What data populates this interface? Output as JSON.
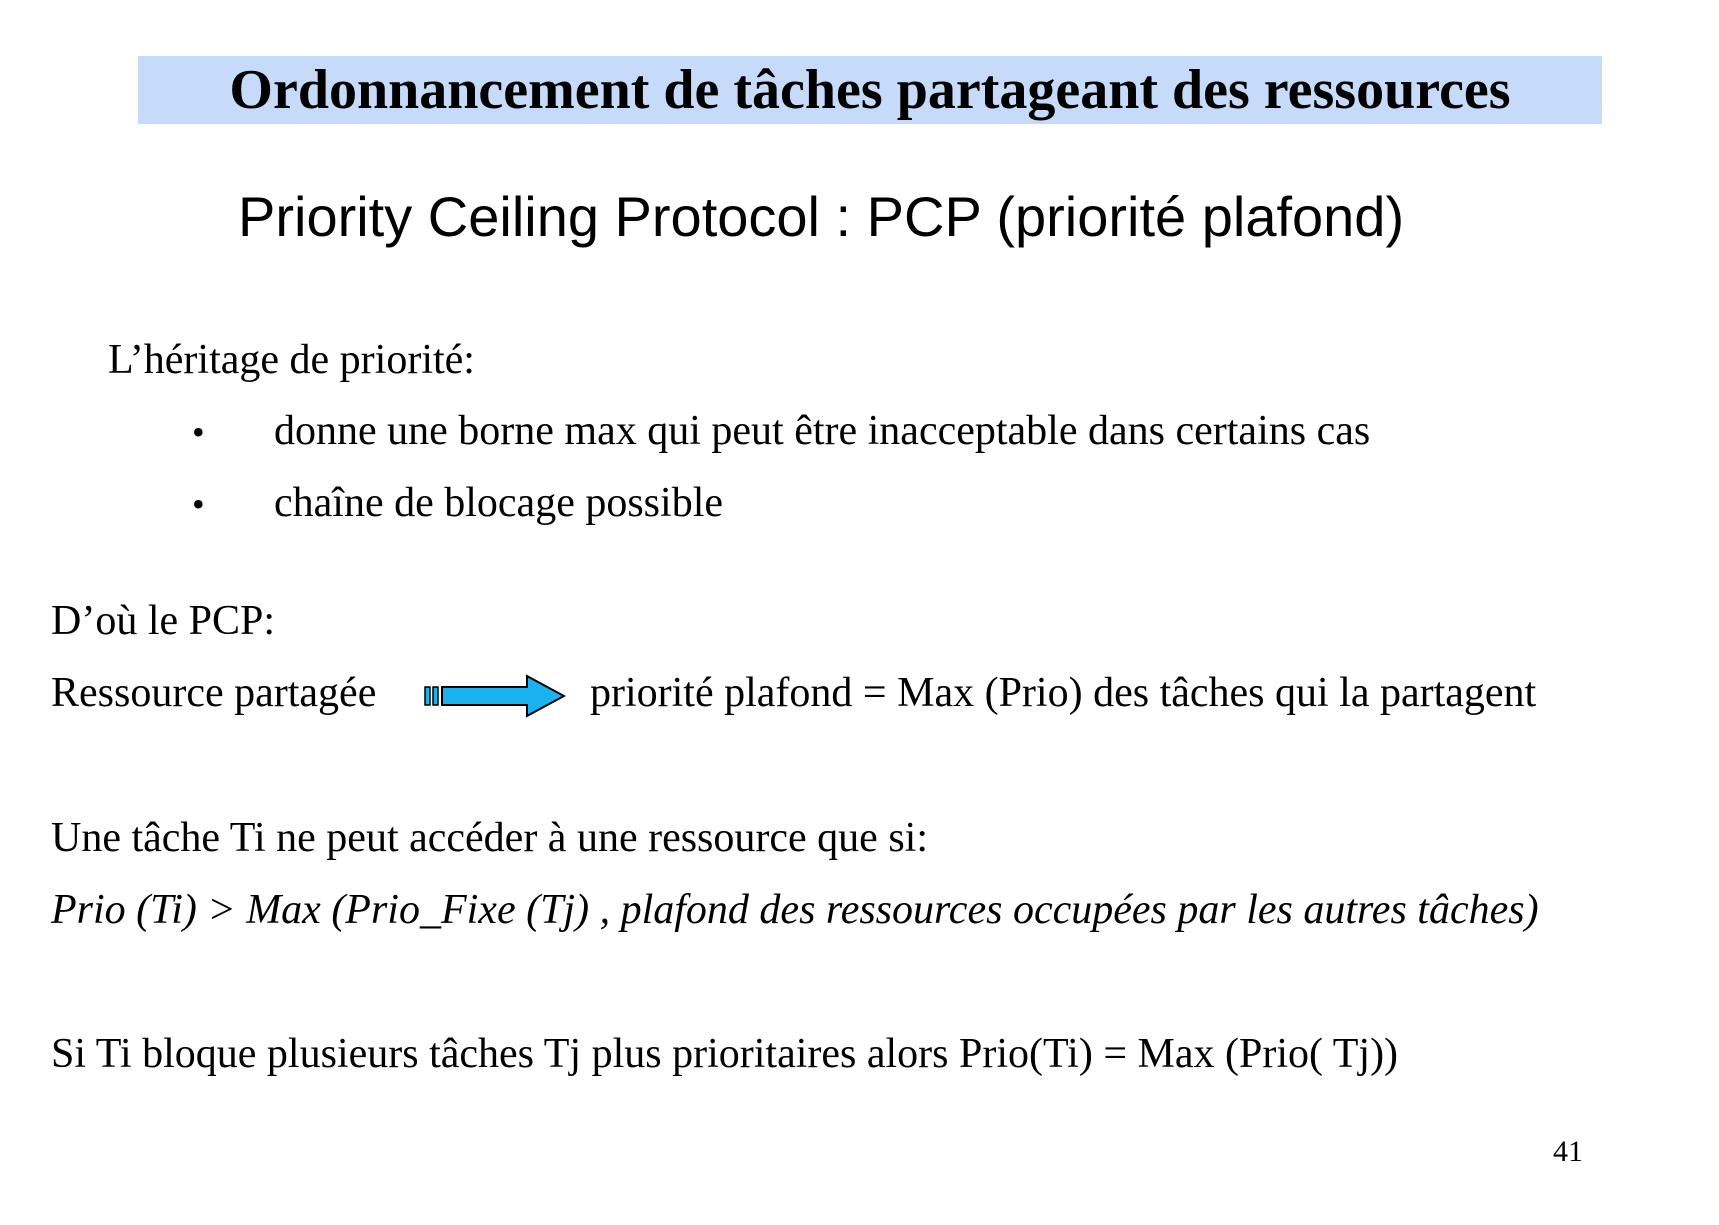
{
  "slide": {
    "title": "Ordonnancement de tâches partageant des ressources",
    "subtitle": "Priority Ceiling Protocol : PCP (priorité plafond)",
    "inheritance_heading": "L’héritage de priorité:",
    "bullets": [
      "donne une borne max qui peut être inacceptable dans certains cas",
      "chaîne de blocage possible"
    ],
    "bullet_symbol": "•",
    "pcp_heading": "D’où le PCP:",
    "resource_left": "Ressource partagée",
    "resource_right": "priorité plafond = Max (Prio) des tâches qui la partagent",
    "access_condition": "Une tâche Ti ne peut accéder à une ressource que si:",
    "formula": "Prio (Ti)  > Max (Prio_Fixe (Tj) , plafond des ressources occupées par les autres tâches)",
    "blocking_rule": "Si Ti bloque plusieurs tâches Tj plus prioritaires alors Prio(Ti) = Max (Prio( Tj))",
    "page_number": "41",
    "arrow_icon": "right-arrow-icon",
    "colors": {
      "title_background": "#c6dbfa",
      "arrow_fill": "#1ab2f0",
      "text": "#000000"
    }
  }
}
